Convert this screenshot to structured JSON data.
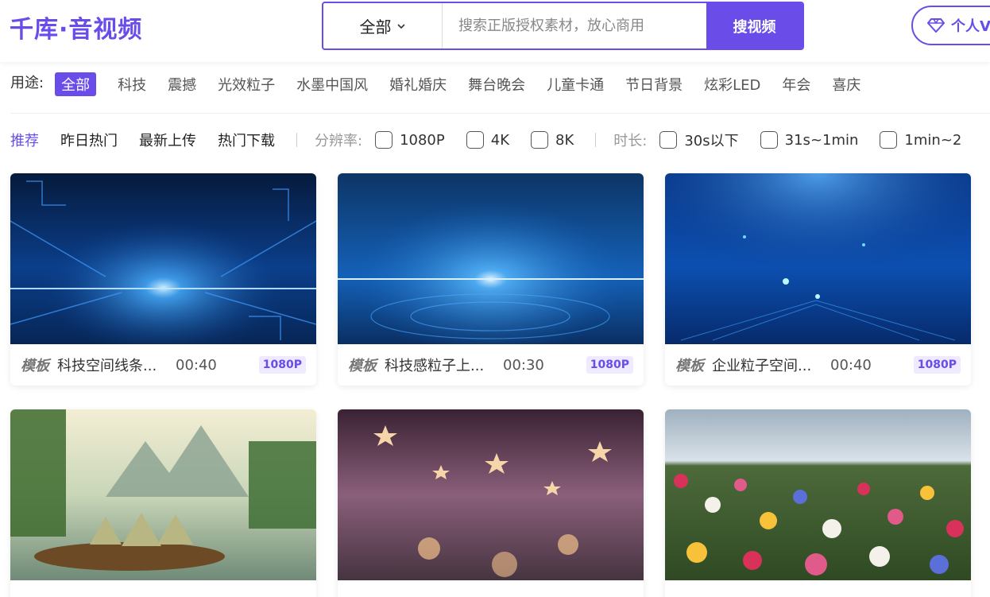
{
  "header": {
    "logo": "千库·音视频",
    "search_category": "全部",
    "search_placeholder": "搜索正版授权素材，放心商用",
    "search_button": "搜视频",
    "vip_label": "个人V"
  },
  "purpose": {
    "label": "用途:",
    "tags": [
      "全部",
      "科技",
      "震撼",
      "光效粒子",
      "水墨中国风",
      "婚礼婚庆",
      "舞台晚会",
      "儿童卡通",
      "节日背景",
      "炫彩LED",
      "年会",
      "喜庆"
    ],
    "active_index": 0
  },
  "filters": {
    "sorts": [
      "推荐",
      "昨日热门",
      "最新上传",
      "热门下载"
    ],
    "resolution_label": "分辨率:",
    "resolutions": [
      "1080P",
      "4K",
      "8K"
    ],
    "duration_label": "时长:",
    "durations": [
      "30s以下",
      "31s~1min",
      "1min~2"
    ]
  },
  "cards": [
    {
      "kind": "模板",
      "title": "科技空间线条...",
      "duration": "00:40",
      "resolution": "1080P",
      "thumb": "tech-lines"
    },
    {
      "kind": "模板",
      "title": "科技感粒子上...",
      "duration": "00:30",
      "resolution": "1080P",
      "thumb": "tech-particles"
    },
    {
      "kind": "模板",
      "title": "企业粒子空间...",
      "duration": "00:40",
      "resolution": "1080P",
      "thumb": "enterprise-particles"
    },
    {
      "kind": "",
      "title": "",
      "duration": "",
      "resolution": "",
      "thumb": "zongzi-landscape"
    },
    {
      "kind": "",
      "title": "",
      "duration": "",
      "resolution": "",
      "thumb": "stars-bokeh"
    },
    {
      "kind": "",
      "title": "",
      "duration": "",
      "resolution": "",
      "thumb": "flower-field"
    }
  ],
  "colors": {
    "accent": "#6a4ce8",
    "tag_bg": "#efeaff"
  }
}
